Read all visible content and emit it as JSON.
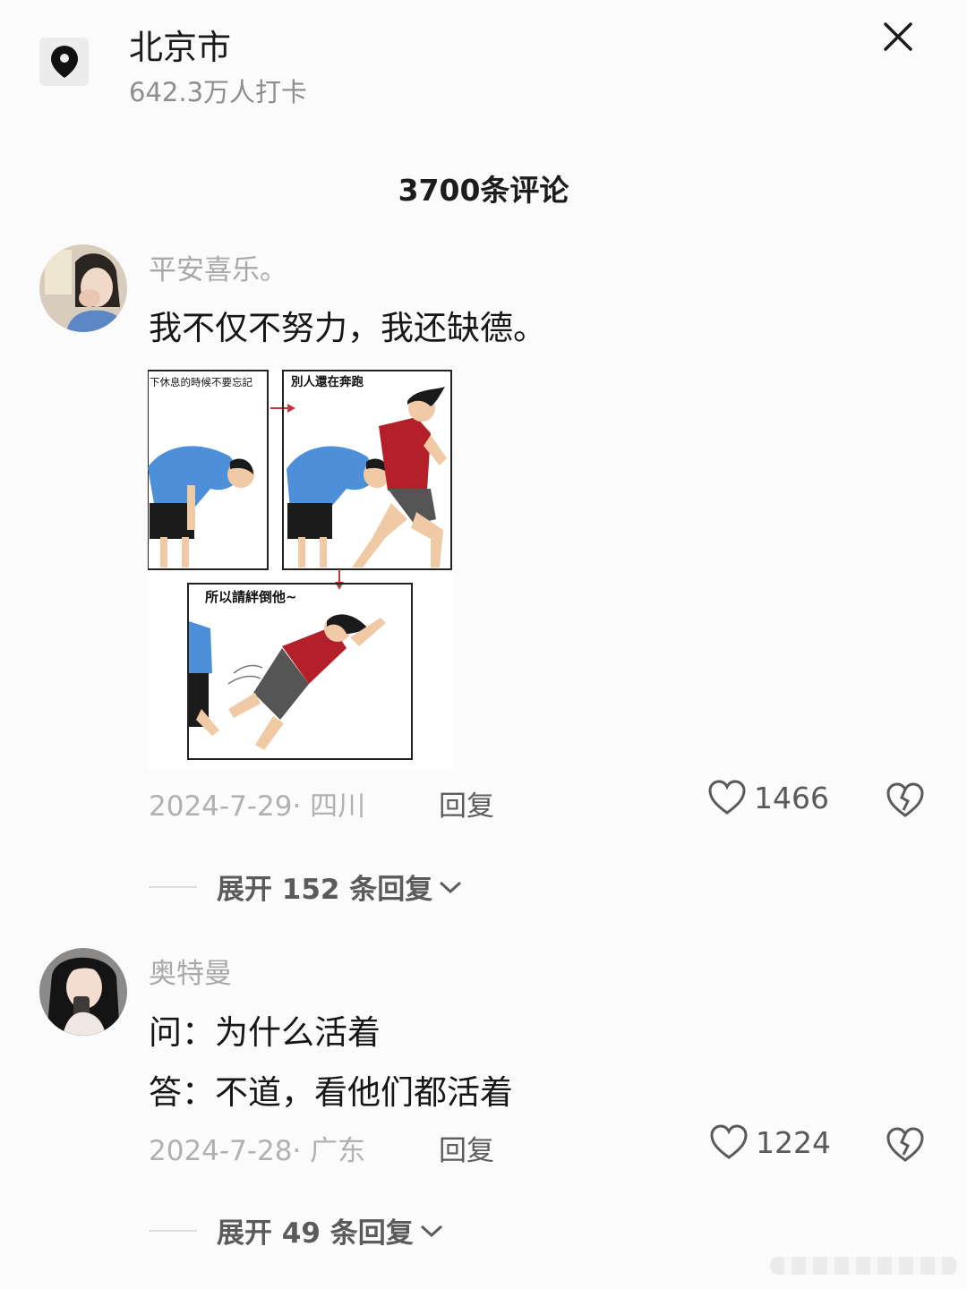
{
  "header": {
    "location_name": "北京市",
    "checkin_count": "642.3万人打卡"
  },
  "comments_header": {
    "count_label": "3700条评论"
  },
  "comments": [
    {
      "username": "平安喜乐。",
      "text": "我不仅不努力，我还缺德。",
      "image": {
        "panel1_caption": "下休息的時候不要忘記",
        "panel2_caption": "別人還在奔跑",
        "panel3_caption": "所以請絆倒他~"
      },
      "date_location": "2024-7-29· 四川",
      "reply_label": "回复",
      "likes": "1466",
      "expand_label": "展开 152 条回复"
    },
    {
      "username": "奥特曼",
      "text_line1": "问：为什么活着",
      "text_line2": "答：不道，看他们都活着",
      "date_location": "2024-7-28· 广东",
      "reply_label": "回复",
      "likes": "1224",
      "expand_label": "展开 49 条回复"
    }
  ],
  "colors": {
    "accent_text": "#161616",
    "muted": "#a9a9a9",
    "shirt_blue": "#4d8fd9",
    "shirt_red": "#b3202a"
  }
}
